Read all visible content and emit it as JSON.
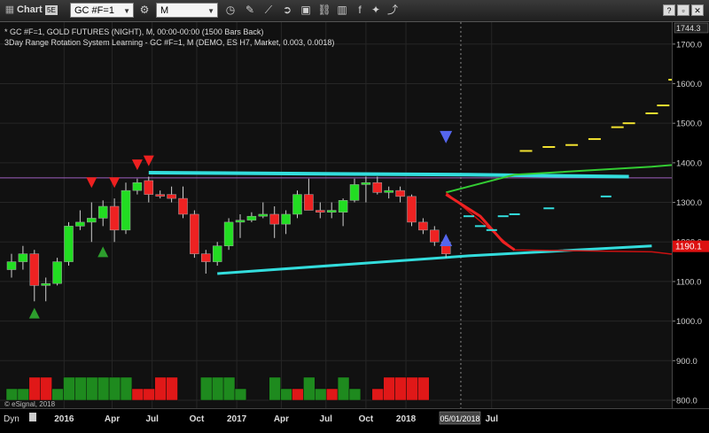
{
  "toolbar": {
    "chart_label": "Chart",
    "badge": "5E",
    "symbol": "GC #F=1",
    "interval": "M",
    "window_buttons": [
      "?",
      "▫",
      "✕"
    ]
  },
  "legend": {
    "line1": "* GC #F=1, GOLD FUTURES (NIGHT), M, 00:00-00:00 (1500 Bars Back)",
    "line2": "3Day Range Rotation System Learning - GC #F=1, M (DEMO, ES H7, Market, 0.003, 0.0018)"
  },
  "watermark": "© eSignal, 2018",
  "bottom_left_label": "Dyn",
  "cursor_date": "05/01/2018",
  "price_axis": {
    "labels": [
      "1700.0",
      "1600.0",
      "1500.0",
      "1400.0",
      "1300.0",
      "1200.0",
      "1100.0",
      "1000.0",
      "900.0",
      "800.0"
    ],
    "top_label": "1744.3",
    "last_price": "1190.1"
  },
  "time_axis": {
    "labels": [
      "2016",
      "Apr",
      "Jul",
      "Oct",
      "2017",
      "Apr",
      "Jul",
      "Oct",
      "2018",
      "Jul"
    ]
  },
  "colors": {
    "up": "#22dd22",
    "down": "#ee2222",
    "cyan": "#33dddd",
    "yellow": "#f0e030",
    "signal_down": "#ee2020",
    "signal_up": "#2d9e2d",
    "signal_blue": "#5566ee"
  },
  "chart_data": {
    "type": "candlestick",
    "title": "* GC #F=1, GOLD FUTURES (NIGHT), M, 00:00-00:00 (1500 Bars Back)",
    "subtitle": "3Day Range Rotation System Learning - GC #F=1, M (DEMO, ES H7, Market, 0.003, 0.0018)",
    "y_range": [
      800,
      1744.3
    ],
    "last_price": 1190.1,
    "bars": [
      {
        "o": 1130,
        "h": 1170,
        "l": 1110,
        "c": 1150
      },
      {
        "o": 1150,
        "h": 1190,
        "l": 1130,
        "c": 1170
      },
      {
        "o": 1170,
        "h": 1180,
        "l": 1050,
        "c": 1090
      },
      {
        "o": 1090,
        "h": 1110,
        "l": 1050,
        "c": 1095
      },
      {
        "o": 1095,
        "h": 1160,
        "l": 1090,
        "c": 1150
      },
      {
        "o": 1150,
        "h": 1250,
        "l": 1140,
        "c": 1240
      },
      {
        "o": 1240,
        "h": 1280,
        "l": 1230,
        "c": 1250
      },
      {
        "o": 1250,
        "h": 1300,
        "l": 1200,
        "c": 1260
      },
      {
        "o": 1260,
        "h": 1305,
        "l": 1240,
        "c": 1290
      },
      {
        "o": 1290,
        "h": 1310,
        "l": 1200,
        "c": 1230
      },
      {
        "o": 1230,
        "h": 1350,
        "l": 1220,
        "c": 1330
      },
      {
        "o": 1330,
        "h": 1360,
        "l": 1320,
        "c": 1350
      },
      {
        "o": 1355,
        "h": 1365,
        "l": 1300,
        "c": 1320
      },
      {
        "o": 1320,
        "h": 1330,
        "l": 1310,
        "c": 1318
      },
      {
        "o": 1320,
        "h": 1340,
        "l": 1300,
        "c": 1310
      },
      {
        "o": 1310,
        "h": 1340,
        "l": 1260,
        "c": 1270
      },
      {
        "o": 1270,
        "h": 1280,
        "l": 1160,
        "c": 1170
      },
      {
        "o": 1170,
        "h": 1180,
        "l": 1120,
        "c": 1150
      },
      {
        "o": 1150,
        "h": 1200,
        "l": 1140,
        "c": 1190
      },
      {
        "o": 1190,
        "h": 1260,
        "l": 1180,
        "c": 1250
      },
      {
        "o": 1250,
        "h": 1270,
        "l": 1210,
        "c": 1255
      },
      {
        "o": 1255,
        "h": 1275,
        "l": 1250,
        "c": 1265
      },
      {
        "o": 1265,
        "h": 1300,
        "l": 1260,
        "c": 1270
      },
      {
        "o": 1270,
        "h": 1290,
        "l": 1210,
        "c": 1245
      },
      {
        "o": 1245,
        "h": 1280,
        "l": 1220,
        "c": 1270
      },
      {
        "o": 1270,
        "h": 1330,
        "l": 1260,
        "c": 1320
      },
      {
        "o": 1320,
        "h": 1360,
        "l": 1300,
        "c": 1280
      },
      {
        "o": 1280,
        "h": 1300,
        "l": 1260,
        "c": 1275
      },
      {
        "o": 1275,
        "h": 1300,
        "l": 1260,
        "c": 1280
      },
      {
        "o": 1275,
        "h": 1310,
        "l": 1240,
        "c": 1305
      },
      {
        "o": 1305,
        "h": 1360,
        "l": 1300,
        "c": 1345
      },
      {
        "o": 1345,
        "h": 1365,
        "l": 1300,
        "c": 1350
      },
      {
        "o": 1350,
        "h": 1365,
        "l": 1320,
        "c": 1325
      },
      {
        "o": 1325,
        "h": 1340,
        "l": 1310,
        "c": 1330
      },
      {
        "o": 1330,
        "h": 1340,
        "l": 1300,
        "c": 1315
      },
      {
        "o": 1315,
        "h": 1320,
        "l": 1240,
        "c": 1250
      },
      {
        "o": 1250,
        "h": 1260,
        "l": 1220,
        "c": 1230
      },
      {
        "o": 1230,
        "h": 1240,
        "l": 1190,
        "c": 1200
      },
      {
        "o": 1200,
        "h": 1210,
        "l": 1160,
        "c": 1170
      }
    ],
    "hist": [
      {
        "v": 1,
        "up": true
      },
      {
        "v": 1,
        "up": true
      },
      {
        "v": 2,
        "up": false
      },
      {
        "v": 2,
        "up": false
      },
      {
        "v": 1,
        "up": true
      },
      {
        "v": 2,
        "up": true
      },
      {
        "v": 2,
        "up": true
      },
      {
        "v": 2,
        "up": true
      },
      {
        "v": 2,
        "up": true
      },
      {
        "v": 2,
        "up": true
      },
      {
        "v": 2,
        "up": true
      },
      {
        "v": 1,
        "up": false
      },
      {
        "v": 1,
        "up": false
      },
      {
        "v": 2,
        "up": false
      },
      {
        "v": 2,
        "up": false
      },
      {
        "v": 0,
        "up": true
      },
      {
        "v": 0,
        "up": true
      },
      {
        "v": 2,
        "up": true
      },
      {
        "v": 2,
        "up": true
      },
      {
        "v": 2,
        "up": true
      },
      {
        "v": 1,
        "up": true
      },
      {
        "v": 0,
        "up": true
      },
      {
        "v": 0,
        "up": true
      },
      {
        "v": 2,
        "up": true
      },
      {
        "v": 1,
        "up": true
      },
      {
        "v": 1,
        "up": false
      },
      {
        "v": 2,
        "up": true
      },
      {
        "v": 1,
        "up": true
      },
      {
        "v": 1,
        "up": false
      },
      {
        "v": 2,
        "up": true
      },
      {
        "v": 1,
        "up": true
      },
      {
        "v": 0,
        "up": true
      },
      {
        "v": 1,
        "up": false
      },
      {
        "v": 2,
        "up": false
      },
      {
        "v": 2,
        "up": false
      },
      {
        "v": 2,
        "up": false
      },
      {
        "v": 2,
        "up": false
      },
      {
        "v": 0,
        "up": true
      },
      {
        "v": 0,
        "up": true
      }
    ],
    "signals": [
      {
        "type": "up_arrow",
        "bar": 2,
        "price": 1020
      },
      {
        "type": "up_arrow",
        "bar": 8,
        "price": 1175
      },
      {
        "type": "down_arrow",
        "bar": 7,
        "price": 1350
      },
      {
        "type": "down_arrow",
        "bar": 9,
        "price": 1350
      },
      {
        "type": "down_arrow",
        "bar": 11,
        "price": 1395
      },
      {
        "type": "down_arrow",
        "bar": 12,
        "price": 1405
      },
      {
        "type": "down_arrow",
        "bar": 38,
        "price": 1465
      },
      {
        "type": "up_arrow_blue",
        "bar": 38,
        "price": 1205
      }
    ],
    "cyan_resistance": [
      [
        12,
        1375
      ],
      [
        40,
        1370
      ],
      [
        54,
        1365
      ]
    ],
    "cyan_support": [
      [
        18,
        1120
      ],
      [
        40,
        1165
      ],
      [
        56,
        1190
      ]
    ],
    "green_projection": [
      [
        38,
        1325
      ],
      [
        44,
        1370
      ],
      [
        56,
        1390
      ],
      [
        62,
        1405
      ]
    ],
    "red_projection": [
      [
        38,
        1325
      ],
      [
        44,
        1180
      ],
      [
        56,
        1175
      ],
      [
        62,
        1155
      ]
    ],
    "red_drop": [
      [
        38,
        1320
      ],
      [
        41,
        1265
      ],
      [
        43,
        1200
      ],
      [
        44,
        1180
      ]
    ],
    "purple_level": 1362,
    "cyan_dashes": [
      [
        40,
        1265
      ],
      [
        41,
        1240
      ],
      [
        42,
        1230
      ],
      [
        43,
        1265
      ],
      [
        44,
        1270
      ],
      [
        47,
        1285
      ],
      [
        52,
        1315
      ]
    ],
    "yellow_dashes": [
      [
        45,
        1430
      ],
      [
        47,
        1440
      ],
      [
        49,
        1445
      ],
      [
        51,
        1460
      ],
      [
        53,
        1490
      ],
      [
        54,
        1500
      ],
      [
        56,
        1525
      ],
      [
        57,
        1545
      ],
      [
        58,
        1610
      ],
      [
        59,
        1595
      ],
      [
        60,
        1580
      ]
    ],
    "time_labels": [
      {
        "label": "2016",
        "bar": 4.6
      },
      {
        "label": "Apr",
        "bar": 8.8
      },
      {
        "label": "Jul",
        "bar": 12.3
      },
      {
        "label": "Oct",
        "bar": 16.2
      },
      {
        "label": "2017",
        "bar": 19.7
      },
      {
        "label": "Apr",
        "bar": 23.6
      },
      {
        "label": "Jul",
        "bar": 27.5
      },
      {
        "label": "Oct",
        "bar": 31.0
      },
      {
        "label": "2018",
        "bar": 34.5
      },
      {
        "label": "Jul",
        "bar": 42.0
      }
    ],
    "cursor_bar": 39.3
  }
}
